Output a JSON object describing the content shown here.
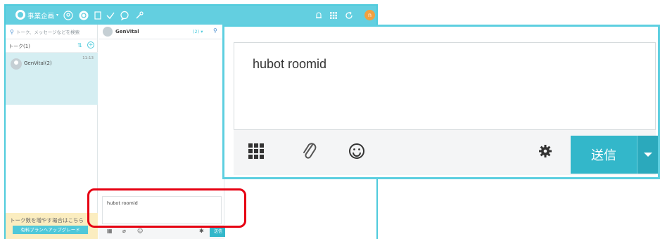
{
  "header": {
    "org_name": "事業企画",
    "avatar_initial": "n"
  },
  "sidebar": {
    "search_placeholder": "トーク、メッセージなどを検索",
    "talk_header": "トーク(1)",
    "talks": [
      {
        "name": "GenVital(2)",
        "time": "11:13"
      }
    ],
    "upgrade_notice": "トーク数を増やす場合はこちら",
    "upgrade_button": "有料プランへアップグレード"
  },
  "chat": {
    "title": "GenVital",
    "member_count": "(2)",
    "message_draft": "hubot roomid",
    "send_label": "送信"
  },
  "zoom": {
    "message_draft": "hubot roomid",
    "send_label": "送信"
  },
  "colors": {
    "accent": "#63cfe0",
    "send_button": "#33b7ca",
    "highlight": "#e60012",
    "selected_row": "#d5eef2",
    "upgrade_bg": "#fbedc0"
  }
}
